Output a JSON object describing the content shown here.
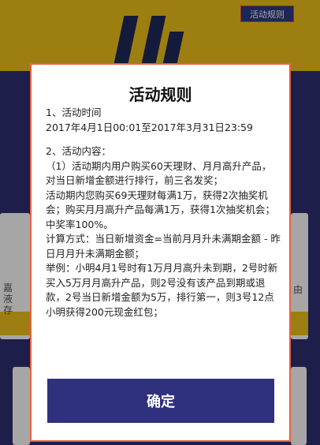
{
  "header": {
    "rules_link": "活动规则"
  },
  "background": {
    "left_fragment": "嘉\n液\n存",
    "right_fragment": "由"
  },
  "modal": {
    "title": "活动规则",
    "section1_heading": "1、活动时间",
    "section1_time": "2017年4月1日00:01至2017年3月31日23:59",
    "section2_heading": "2、活动内容：",
    "para1": "（1）活动期内用户购买60天理财、月月高升产品，对当日新增金额进行排行，前三名发奖；",
    "para2": "活动期内您购买69天理财每满1万，获得2次抽奖机会；购买月月高升产品每满1万，获得1次抽奖机会；中奖率100%。",
    "para3": "计算方式：当日新增资金=当前月月升未满期金额 - 昨日月月升未满期金额；",
    "para4": "举例：小明4月1号时有1万月月高升未到期，2号时新买入5万月月高升产品，则2号没有该产品到期或退款，2号当日新增金额为5万，排行第一，则3号12点小明获得200元现金红包；",
    "confirm_label": "确定"
  }
}
